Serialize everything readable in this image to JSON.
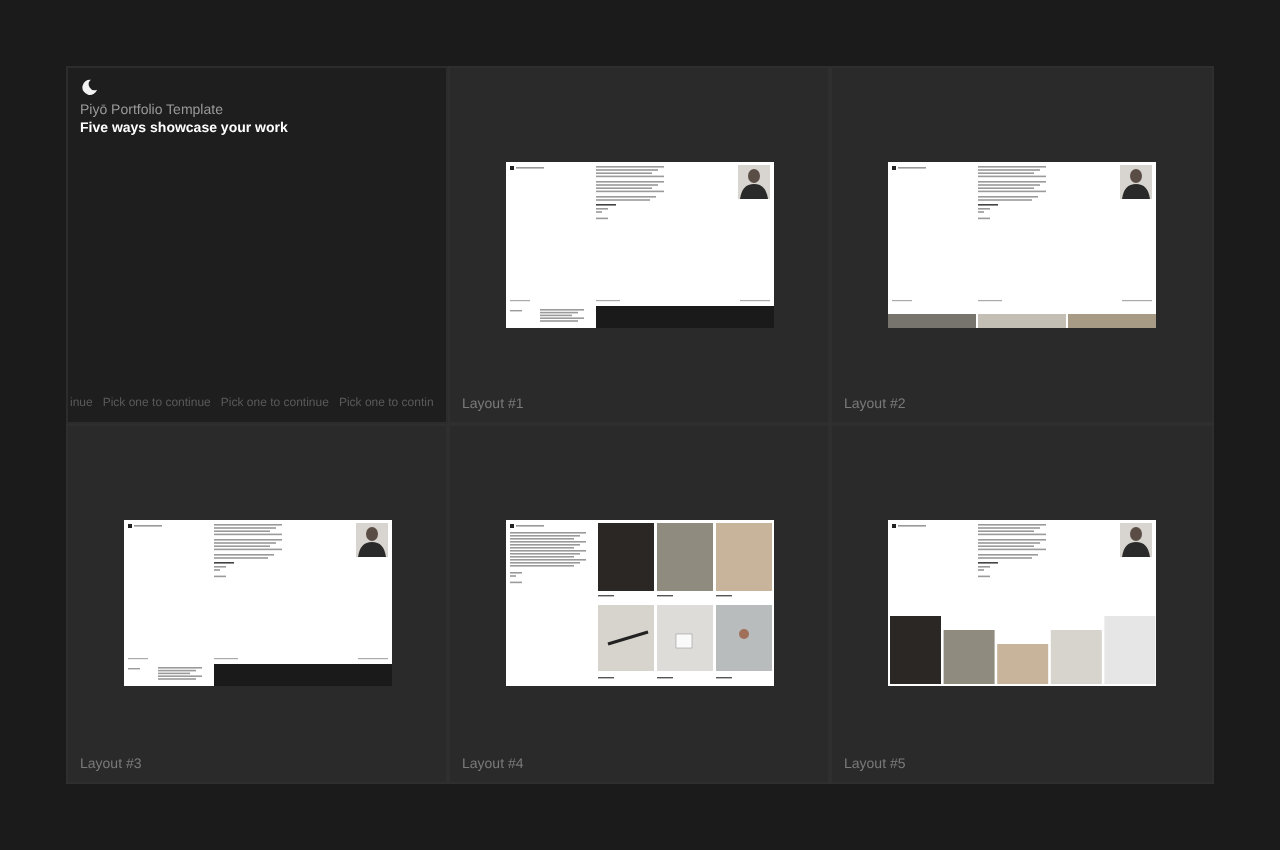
{
  "intro": {
    "title": "Piyō Portfolio Template",
    "subtitle": "Five ways showcase your work"
  },
  "marquee": [
    "inue",
    "Pick one to continue",
    "Pick one to continue",
    "Pick one to contin"
  ],
  "layouts": [
    {
      "label": "Layout #1",
      "kind": "bio"
    },
    {
      "label": "Layout #2",
      "kind": "strip"
    },
    {
      "label": "Layout #3",
      "kind": "bio"
    },
    {
      "label": "Layout #4",
      "kind": "grid"
    },
    {
      "label": "Layout #5",
      "kind": "row"
    }
  ]
}
